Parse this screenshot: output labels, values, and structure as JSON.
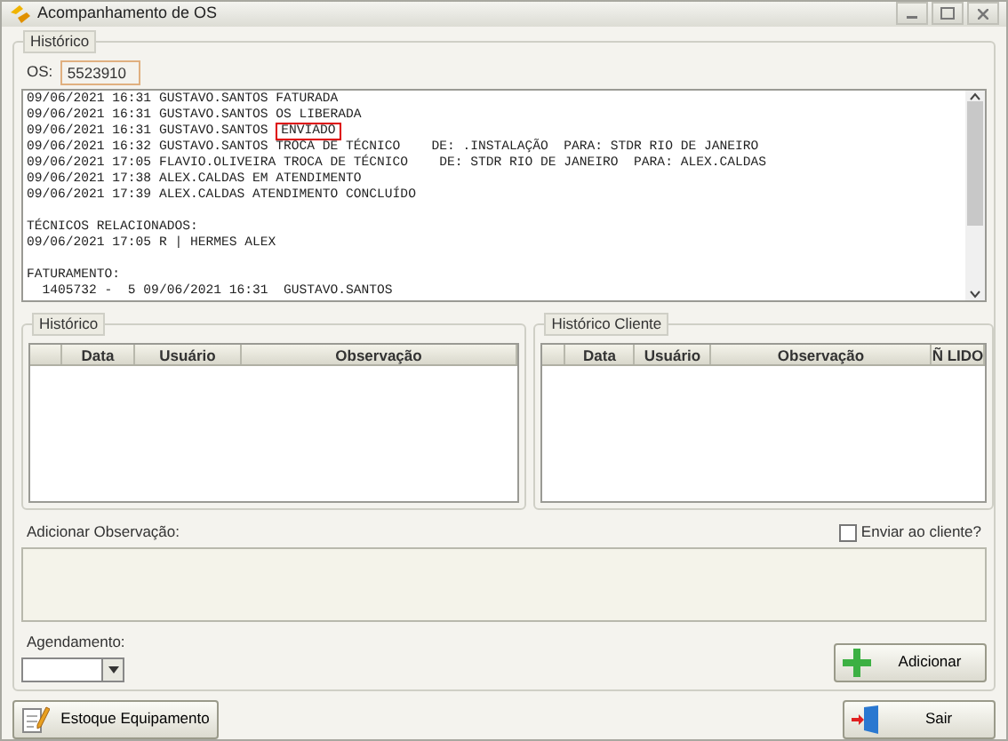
{
  "window": {
    "title": "Acompanhamento de OS"
  },
  "historico": {
    "legend": "Histórico",
    "os_label": "OS:",
    "os_value": "5523910",
    "log_blocks": [
      [
        {
          "text": "09/06/2021 16:31 GUSTAVO.SANTOS FATURADA"
        },
        {
          "text": "09/06/2021 16:31 GUSTAVO.SANTOS OS LIBERADA"
        },
        {
          "text": "09/06/2021 16:31 GUSTAVO.SANTOS",
          "boxed": "ENVIADO"
        },
        {
          "text": "09/06/2021 16:32 GUSTAVO.SANTOS TROCA DE TÉCNICO    DE: .INSTALAÇÃO  PARA: STDR RIO DE JANEIRO"
        },
        {
          "text": "09/06/2021 17:05 FLAVIO.OLIVEIRA TROCA DE TÉCNICO    DE: STDR RIO DE JANEIRO  PARA: ALEX.CALDAS"
        },
        {
          "text": "09/06/2021 17:38 ALEX.CALDAS EM ATENDIMENTO"
        },
        {
          "text": "09/06/2021 17:39 ALEX.CALDAS ATENDIMENTO CONCLUÍDO"
        }
      ],
      [
        {
          "text": "TÉCNICOS RELACIONADOS:"
        },
        {
          "text": "09/06/2021 17:05 R | HERMES ALEX"
        }
      ],
      [
        {
          "text": "FATURAMENTO:"
        },
        {
          "text": "  1405732 -  5 09/06/2021 16:31  GUSTAVO.SANTOS"
        }
      ]
    ]
  },
  "grids": [
    {
      "legend": "Histórico",
      "columns": [
        "Data",
        "Usuário",
        "Observação"
      ]
    },
    {
      "legend": "Histórico Cliente",
      "columns": [
        "Data",
        "Usuário",
        "Observação",
        "Ñ LIDO"
      ]
    }
  ],
  "observacao": {
    "label": "Adicionar Observação:",
    "send_label": "Enviar ao cliente?",
    "send_checked": false
  },
  "agendamento": {
    "label": "Agendamento:"
  },
  "buttons": {
    "add": "Adicionar",
    "stock": "Estoque Equipamento",
    "exit": "Sair"
  }
}
